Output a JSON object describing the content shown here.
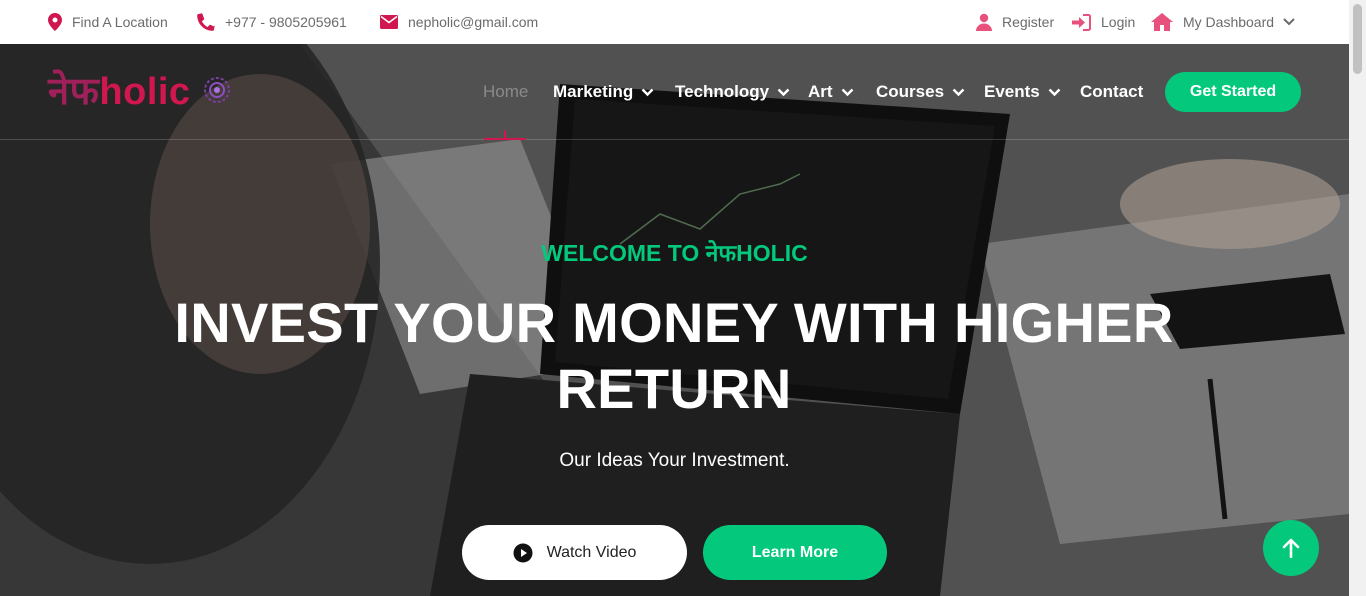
{
  "topbar": {
    "location": "Find A Location",
    "phone": "+977 - 9805205961",
    "email": "nepholic@gmail.com",
    "register": "Register",
    "login": "Login",
    "dashboard": "My Dashboard"
  },
  "brand": {
    "logo_devanagari": "नेफ",
    "logo_latin": "holic"
  },
  "nav": {
    "items": [
      {
        "label": "Home",
        "active": true
      },
      {
        "label": "Marketing",
        "dropdown": true
      },
      {
        "label": "Technology",
        "dropdown": true
      },
      {
        "label": "Art",
        "dropdown": true
      },
      {
        "label": "Courses",
        "dropdown": true
      },
      {
        "label": "Events",
        "dropdown": true
      },
      {
        "label": "Contact"
      }
    ],
    "cta": "Get Started"
  },
  "hero": {
    "welcome": "WELCOME TO नेफHOLIC",
    "headline": "INVEST YOUR MONEY WITH HIGHER RETURN",
    "subline": "Our Ideas Your Investment.",
    "watch_label": "Watch Video",
    "learn_label": "Learn More"
  },
  "colors": {
    "accent_green": "#04c97c",
    "brand_red": "#d0174f",
    "icon_pink": "#e8517b"
  }
}
